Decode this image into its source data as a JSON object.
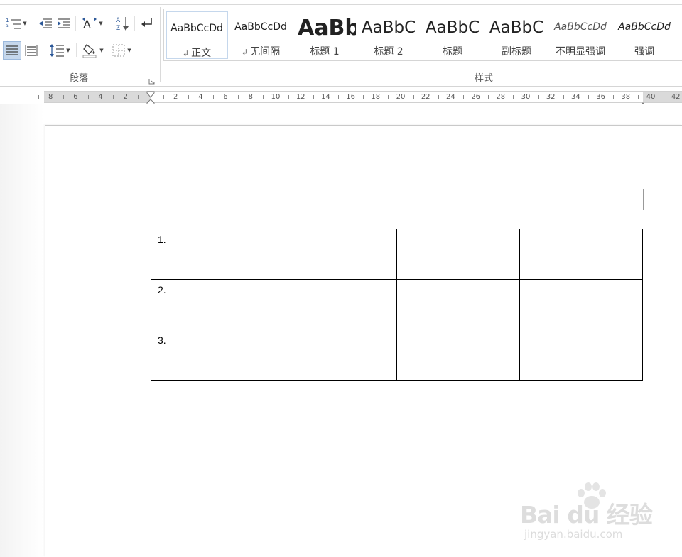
{
  "ribbon": {
    "paragraph_group": {
      "label": "段落"
    },
    "styles_group": {
      "label": "样式"
    },
    "icons": [
      "numbering-list-icon",
      "decrease-indent-icon",
      "increase-indent-icon",
      "asian-layout-icon",
      "sort-icon",
      "show-marks-icon",
      "align-distributed-icon",
      "justify-low-icon",
      "line-spacing-icon",
      "shading-icon",
      "borders-icon",
      "paragraph-dialog-launcher-icon"
    ],
    "gallery": [
      {
        "sample": "AaBbCcDd",
        "name": "正文",
        "mark": "↲",
        "selected": true
      },
      {
        "sample": "AaBbCcDd",
        "name": "无间隔",
        "mark": "↲",
        "selected": false
      },
      {
        "sample": "AaBb",
        "name": "标题 1",
        "mark": "",
        "selected": false
      },
      {
        "sample": "AaBbC",
        "name": "标题 2",
        "mark": "",
        "selected": false
      },
      {
        "sample": "AaBbC",
        "name": "标题",
        "mark": "",
        "selected": false
      },
      {
        "sample": "AaBbC",
        "name": "副标题",
        "mark": "",
        "selected": false
      },
      {
        "sample": "AaBbCcDd",
        "name": "不明显强调",
        "mark": "",
        "selected": false
      },
      {
        "sample": "AaBbCcDd",
        "name": "强调",
        "mark": "",
        "selected": false
      }
    ]
  },
  "ruler": {
    "labels": [
      "8",
      "6",
      "4",
      "2",
      "2",
      "4",
      "6",
      "8",
      "10",
      "12",
      "14",
      "16",
      "18",
      "20",
      "22",
      "24",
      "26",
      "28",
      "30",
      "32",
      "34",
      "36",
      "38",
      "40",
      "42"
    ]
  },
  "table": {
    "rows": [
      [
        "1.",
        "",
        "",
        ""
      ],
      [
        "2.",
        "",
        "",
        ""
      ],
      [
        "3.",
        "",
        "",
        ""
      ]
    ]
  },
  "watermark": {
    "brand": "Bai du 经验",
    "url": "jingyan.baidu.com"
  }
}
